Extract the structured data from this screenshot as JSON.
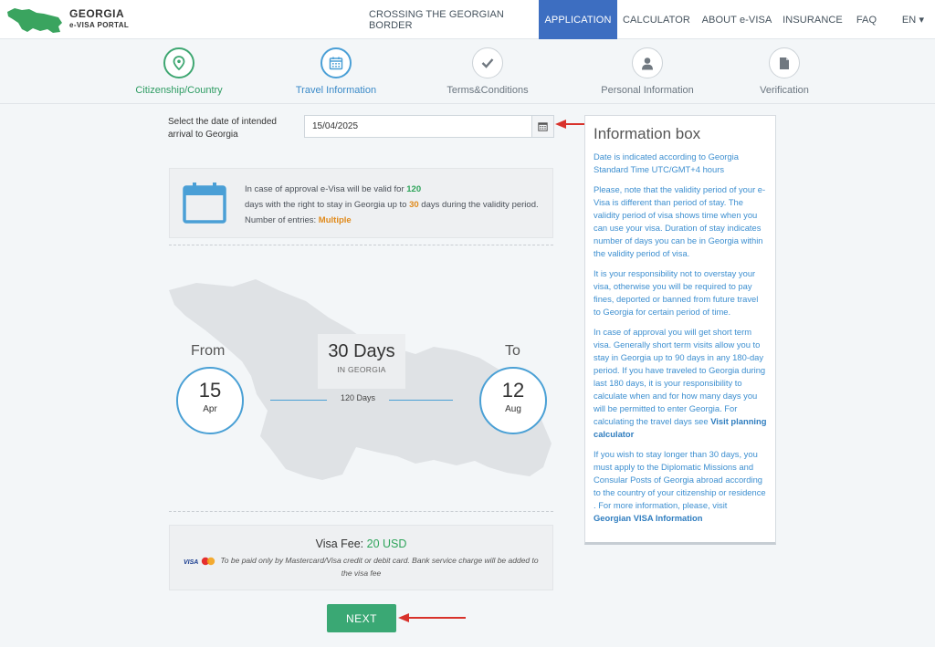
{
  "header": {
    "brand_title": "GEORGIA",
    "brand_subtitle": "e-VISA PORTAL",
    "nav": [
      {
        "label": "CROSSING THE GEORGIAN BORDER",
        "active": false
      },
      {
        "label": "APPLICATION",
        "active": true
      },
      {
        "label": "CALCULATOR",
        "active": false
      },
      {
        "label": "ABOUT e-VISA",
        "active": false
      },
      {
        "label": "INSURANCE",
        "active": false
      },
      {
        "label": "FAQ",
        "active": false
      }
    ],
    "language": "EN ▾"
  },
  "steps": [
    {
      "label": "Citizenship/Country",
      "icon": "location-pin-icon",
      "state": "done"
    },
    {
      "label": "Travel Information",
      "icon": "calendar-icon",
      "state": "current"
    },
    {
      "label": "Terms&Conditions",
      "icon": "checkmark-icon",
      "state": "todo"
    },
    {
      "label": "Personal Information",
      "icon": "person-icon",
      "state": "todo"
    },
    {
      "label": "Verification",
      "icon": "document-icon",
      "state": "todo"
    }
  ],
  "arrival": {
    "label": "Select the date of intended arrival to Georgia",
    "value": "15/04/2025"
  },
  "validity": {
    "line1_prefix": "In case of approval e-Visa will be valid for ",
    "valid_days": "120",
    "line2_prefix": "days with the right to stay in Georgia up to ",
    "stay_days": "30",
    "line2_suffix": " days during the validity period.",
    "entries_label": "Number of entries: ",
    "entries_value": "Multiple"
  },
  "period": {
    "from_label": "From",
    "from_day": "15",
    "from_month": "Apr",
    "to_label": "To",
    "to_day": "12",
    "to_month": "Aug",
    "stay_title": "30 Days",
    "stay_sub": "IN GEORGIA",
    "range_text": "120 Days"
  },
  "fee": {
    "label": "Visa Fee: ",
    "amount": "20 USD",
    "note": "To be paid only by Mastercard/Visa credit or debit card. Bank service charge will be added to the visa fee"
  },
  "next_label": "NEXT",
  "info_box": {
    "title": "Information box",
    "p1": "Date is indicated according to Georgia Standard Time UTC/GMT+4 hours",
    "p2": "Please, note that the validity period of your e-Visa is different than period of stay. The validity period of visa shows time when you can use your visa. Duration of stay indicates number of days you can be in Georgia within the validity period of visa.",
    "p3": "It is your responsibility not to overstay your visa, otherwise you will be required to pay fines, deported or banned from future travel to Georgia for certain period of time.",
    "p4": "In case of approval you will get short term visa. Generally short term visits allow you to stay in Georgia up to 90 days in any 180-day period. If you have traveled to Georgia during last 180 days, it is your responsibility to calculate when and for how many days you will be permitted to enter Georgia. For calculating the travel days see ",
    "p4_link": "Visit planning calculator",
    "p5": "If you wish to stay longer than 30 days, you must apply to the Diplomatic Missions and Consular Posts of Georgia abroad according to the country of your citizenship or residence . For more information, please, visit ",
    "p5_link": "Georgian VISA Information"
  },
  "colors": {
    "accent_blue": "#3d6ec1",
    "green": "#3aa874",
    "orange": "#e08a1b",
    "annotation_red": "#d8322b"
  }
}
